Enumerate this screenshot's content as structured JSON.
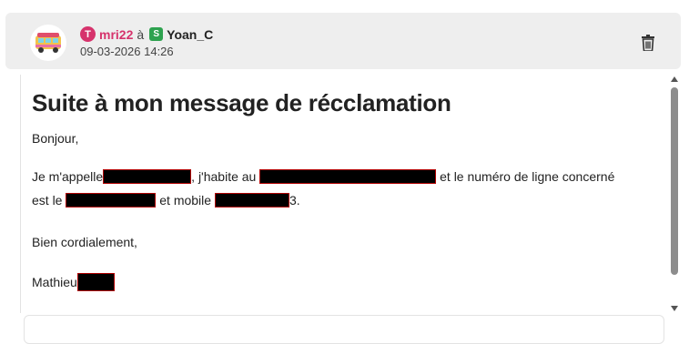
{
  "message": {
    "author": "mri22",
    "preposition": "à",
    "recipient": "Yoan_C",
    "timestamp": "09-03-2026 14:26",
    "author_badge": "T",
    "recipient_badge": "S",
    "title": "Suite à mon message de récclamation",
    "greeting": "Bonjour,",
    "body_l1_a": "Je m'appelle",
    "body_l1_b": ", j'habite au",
    "body_l1_c": "et le numéro de ligne concerné",
    "body_l2_a": "est le",
    "body_l2_b": "et mobile",
    "body_l2_c": "3.",
    "closing": "Bien cordialement,",
    "signature": "Mathieu"
  },
  "icons": {
    "delete": "trash-icon",
    "avatar": "van-avatar-icon"
  },
  "colors": {
    "author": "#d6336c",
    "recipient_badge": "#2ea24f",
    "header_bg": "#eeeeee"
  }
}
